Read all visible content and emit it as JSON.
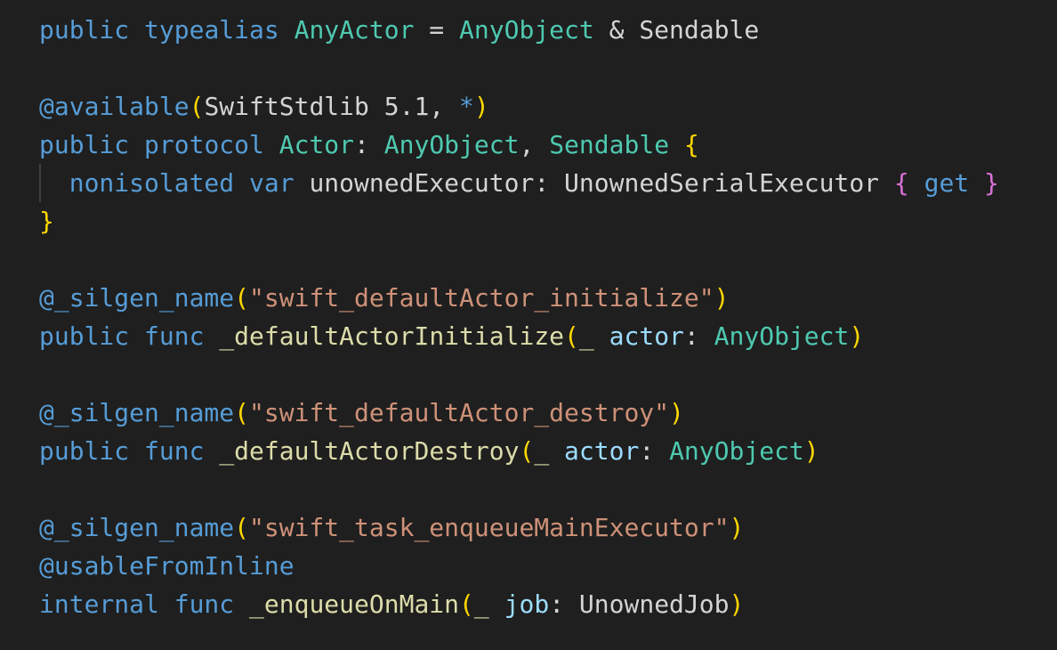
{
  "lines": [
    [
      {
        "t": "public",
        "c": "kw"
      },
      {
        "t": " ",
        "c": "plain"
      },
      {
        "t": "typealias",
        "c": "kw"
      },
      {
        "t": " ",
        "c": "plain"
      },
      {
        "t": "AnyActor",
        "c": "type"
      },
      {
        "t": " = ",
        "c": "plain"
      },
      {
        "t": "AnyObject",
        "c": "type"
      },
      {
        "t": " & Sendable",
        "c": "plain"
      }
    ],
    [],
    [
      {
        "t": "@available",
        "c": "kw"
      },
      {
        "t": "(",
        "c": "brace-y"
      },
      {
        "t": "SwiftStdlib 5.1, ",
        "c": "plain"
      },
      {
        "t": "*",
        "c": "kw"
      },
      {
        "t": ")",
        "c": "brace-y"
      }
    ],
    [
      {
        "t": "public",
        "c": "kw"
      },
      {
        "t": " ",
        "c": "plain"
      },
      {
        "t": "protocol",
        "c": "kw"
      },
      {
        "t": " ",
        "c": "plain"
      },
      {
        "t": "Actor",
        "c": "type"
      },
      {
        "t": ": ",
        "c": "plain"
      },
      {
        "t": "AnyObject",
        "c": "type"
      },
      {
        "t": ", ",
        "c": "plain"
      },
      {
        "t": "Sendable",
        "c": "type"
      },
      {
        "t": " ",
        "c": "plain"
      },
      {
        "t": "{",
        "c": "brace-y"
      }
    ],
    [
      {
        "t": "  ",
        "c": "plain"
      },
      {
        "t": "nonisolated",
        "c": "kw"
      },
      {
        "t": " ",
        "c": "plain"
      },
      {
        "t": "var",
        "c": "kw"
      },
      {
        "t": " unownedExecutor: UnownedSerialExecutor ",
        "c": "plain"
      },
      {
        "t": "{",
        "c": "brace-p"
      },
      {
        "t": " ",
        "c": "plain"
      },
      {
        "t": "get",
        "c": "kw"
      },
      {
        "t": " ",
        "c": "plain"
      },
      {
        "t": "}",
        "c": "brace-p"
      }
    ],
    [
      {
        "t": "}",
        "c": "brace-y"
      }
    ],
    [],
    [
      {
        "t": "@_silgen_name",
        "c": "kw"
      },
      {
        "t": "(",
        "c": "brace-y"
      },
      {
        "t": "\"swift_defaultActor_initialize\"",
        "c": "str"
      },
      {
        "t": ")",
        "c": "brace-y"
      }
    ],
    [
      {
        "t": "public",
        "c": "kw"
      },
      {
        "t": " ",
        "c": "plain"
      },
      {
        "t": "func",
        "c": "kw"
      },
      {
        "t": " ",
        "c": "plain"
      },
      {
        "t": "_defaultActorInitialize",
        "c": "fn"
      },
      {
        "t": "(",
        "c": "brace-y"
      },
      {
        "t": "_",
        "c": "fn"
      },
      {
        "t": " ",
        "c": "plain"
      },
      {
        "t": "actor",
        "c": "param"
      },
      {
        "t": ": ",
        "c": "plain"
      },
      {
        "t": "AnyObject",
        "c": "type"
      },
      {
        "t": ")",
        "c": "brace-y"
      }
    ],
    [],
    [
      {
        "t": "@_silgen_name",
        "c": "kw"
      },
      {
        "t": "(",
        "c": "brace-y"
      },
      {
        "t": "\"swift_defaultActor_destroy\"",
        "c": "str"
      },
      {
        "t": ")",
        "c": "brace-y"
      }
    ],
    [
      {
        "t": "public",
        "c": "kw"
      },
      {
        "t": " ",
        "c": "plain"
      },
      {
        "t": "func",
        "c": "kw"
      },
      {
        "t": " ",
        "c": "plain"
      },
      {
        "t": "_defaultActorDestroy",
        "c": "fn"
      },
      {
        "t": "(",
        "c": "brace-y"
      },
      {
        "t": "_",
        "c": "fn"
      },
      {
        "t": " ",
        "c": "plain"
      },
      {
        "t": "actor",
        "c": "param"
      },
      {
        "t": ": ",
        "c": "plain"
      },
      {
        "t": "AnyObject",
        "c": "type"
      },
      {
        "t": ")",
        "c": "brace-y"
      }
    ],
    [],
    [
      {
        "t": "@_silgen_name",
        "c": "kw"
      },
      {
        "t": "(",
        "c": "brace-y"
      },
      {
        "t": "\"swift_task_enqueueMainExecutor\"",
        "c": "str"
      },
      {
        "t": ")",
        "c": "brace-y"
      }
    ],
    [
      {
        "t": "@usableFromInline",
        "c": "kw"
      }
    ],
    [
      {
        "t": "internal",
        "c": "kw"
      },
      {
        "t": " ",
        "c": "plain"
      },
      {
        "t": "func",
        "c": "kw"
      },
      {
        "t": " ",
        "c": "plain"
      },
      {
        "t": "_enqueueOnMain",
        "c": "fn"
      },
      {
        "t": "(",
        "c": "brace-y"
      },
      {
        "t": "_",
        "c": "fn"
      },
      {
        "t": " ",
        "c": "plain"
      },
      {
        "t": "job",
        "c": "param"
      },
      {
        "t": ": UnownedJob",
        "c": "plain"
      },
      {
        "t": ")",
        "c": "brace-y"
      }
    ]
  ],
  "colors": {
    "background": "#1f1f1f",
    "keyword": "#569cd6",
    "control_keyword": "#c586c0",
    "type": "#4ec9b0",
    "function": "#dcdcaa",
    "string": "#ce9178",
    "parameter": "#9cdcfe",
    "plain": "#d4d4d4",
    "bracket_level1": "#ffd700",
    "bracket_level2": "#da70d6"
  }
}
